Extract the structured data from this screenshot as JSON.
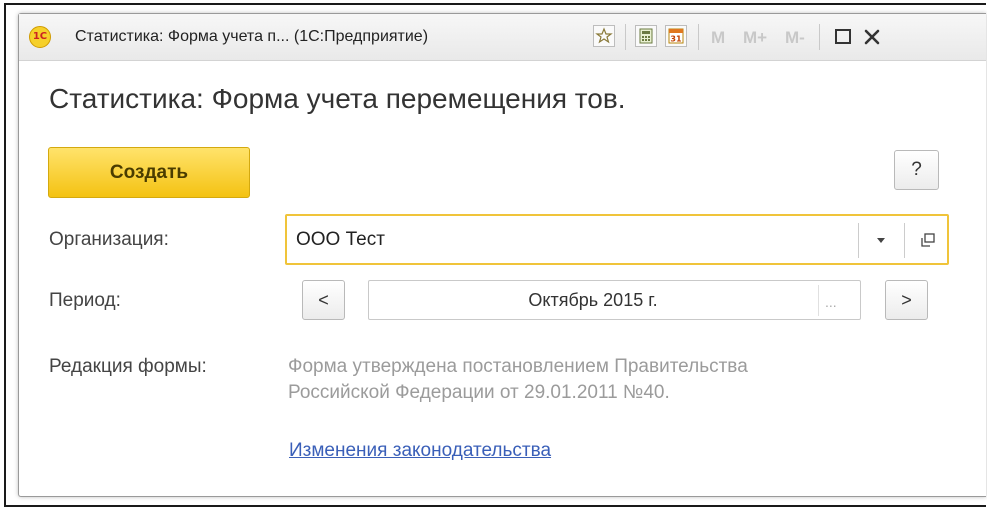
{
  "titlebar": {
    "logo": "1C",
    "title": "Статистика: Форма учета п... (1С:Предприятие)",
    "calendar_day": "31",
    "m_labels": [
      "M",
      "M+",
      "M-"
    ],
    "icons": [
      "favorite-star-icon",
      "calculator-icon",
      "calendar-icon",
      "maximize-icon",
      "close-icon"
    ]
  },
  "form": {
    "heading": "Статистика: Форма учета перемещения тов.",
    "create_label": "Создать",
    "help_label": "?",
    "org_label": "Организация:",
    "org_value": "ООО Тест",
    "period_label": "Период:",
    "period_prev": "<",
    "period_value": "Октябрь 2015 г.",
    "period_dots": "...",
    "period_next": ">",
    "edition_label": "Редакция формы:",
    "edition_line1": "Форма утверждена постановлением Правительства",
    "edition_line2": "Российской Федерации от 29.01.2011 №40.",
    "link_label": "Изменения законодательства"
  },
  "colors": {
    "accent_yellow": "#f4c212",
    "focus_border": "#f0c43a",
    "link": "#3a5fb8",
    "muted_text": "#9b9b9b"
  }
}
